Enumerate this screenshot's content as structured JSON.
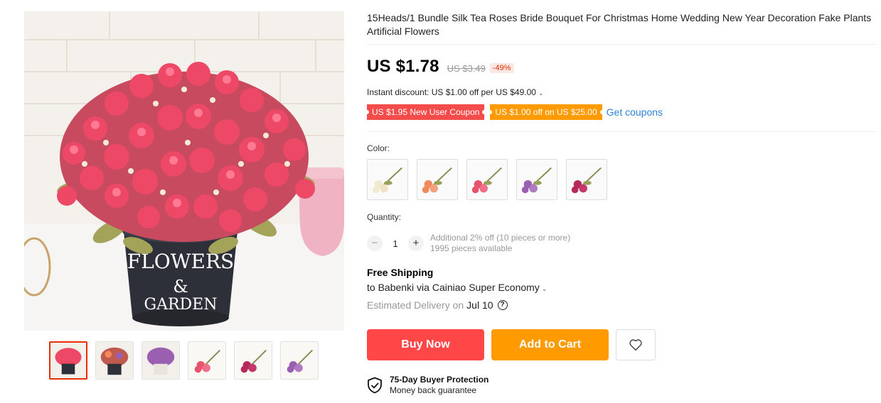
{
  "product": {
    "title": "15Heads/1 Bundle Silk Tea Roses Bride Bouquet For Christmas Home Wedding New Year Decoration Fake Plants Artificial Flowers"
  },
  "gallery": {
    "main_image_text_line1": "FLOWERS",
    "main_image_text_line2": "&",
    "main_image_text_line3": "GARDEN",
    "thumbnails": [
      {
        "name": "pink-roses-bucket"
      },
      {
        "name": "mixed-roses-bucket"
      },
      {
        "name": "purple-roses-bucket"
      },
      {
        "name": "pink-bundle"
      },
      {
        "name": "wine-bundle"
      },
      {
        "name": "purple-bundle"
      }
    ]
  },
  "pricing": {
    "price": "US $1.78",
    "original_price": "US $3.49",
    "discount": "-49%",
    "instant_discount": "Instant discount: US $1.00 off per US $49.00",
    "coupons": [
      {
        "label": "US $1.95 New User Coupon",
        "color": "#f44b4b"
      },
      {
        "label": "US $1.00 off on US $25.00",
        "color": "#ff9a00"
      }
    ],
    "get_coupons": "Get coupons"
  },
  "options": {
    "color_label": "Color:",
    "colors": [
      {
        "name": "champagne",
        "hex": "#f2ead0"
      },
      {
        "name": "orange",
        "hex": "#f08a5d"
      },
      {
        "name": "pink",
        "hex": "#e8526c"
      },
      {
        "name": "purple",
        "hex": "#9a5fb0"
      },
      {
        "name": "wine-red",
        "hex": "#b7295a"
      }
    ],
    "quantity_label": "Quantity:",
    "quantity": "1",
    "quantity_note": "Additional 2% off (10 pieces or more)",
    "available": "1995 pieces available"
  },
  "shipping": {
    "title": "Free Shipping",
    "to": "to Babenki via Cainiao Super Economy",
    "estimated_label": "Estimated Delivery on",
    "date": "Jul 10"
  },
  "actions": {
    "buy_now": "Buy Now",
    "add_to_cart": "Add to Cart"
  },
  "protection": {
    "title": "75-Day Buyer Protection",
    "subtitle": "Money back guarantee"
  },
  "colors": {
    "accent_red": "#ff4747",
    "accent_orange": "#ff9a00",
    "link_blue": "#2e83d6"
  }
}
